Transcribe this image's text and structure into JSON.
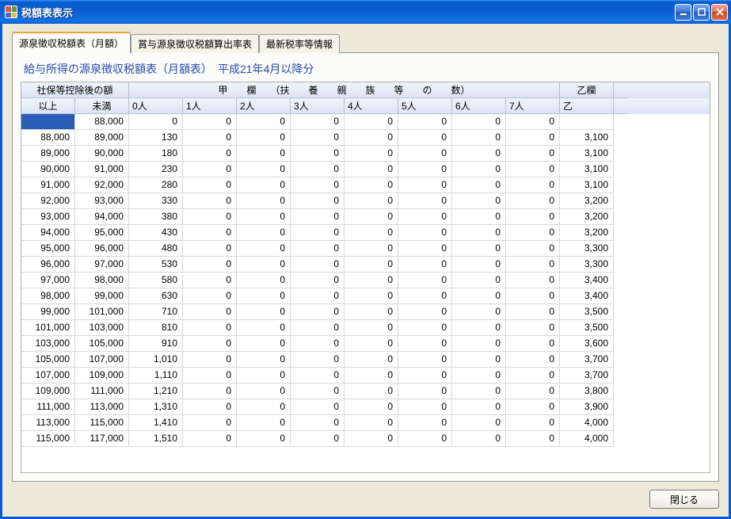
{
  "window": {
    "title": "税額表表示"
  },
  "tabs": [
    {
      "label": "源泉徴収税額表（月額）",
      "active": true
    },
    {
      "label": "賞与源泉徴収税額算出率表",
      "active": false
    },
    {
      "label": "最新税率等情報",
      "active": false
    }
  ],
  "subtitle": "給与所得の源泉徴収税額表（月額表）　平成21年4月以降分",
  "headers": {
    "shakai_span": "社保等控除後の額",
    "kou_span": "甲　　欄　　（扶　　養　　親　　族　　等　　の　　数）",
    "otsu_span": "乙欄",
    "ijo": "以上",
    "miman": "未満",
    "p0": "0人",
    "p1": "1人",
    "p2": "2人",
    "p3": "3人",
    "p4": "4人",
    "p5": "5人",
    "p6": "6人",
    "p7": "7人",
    "otsu": "乙"
  },
  "rows": [
    {
      "ijo": "",
      "miman": "88,000",
      "p0": "0",
      "p1": "0",
      "p2": "0",
      "p3": "0",
      "p4": "0",
      "p5": "0",
      "p6": "0",
      "p7": "0",
      "otsu": ""
    },
    {
      "ijo": "88,000",
      "miman": "89,000",
      "p0": "130",
      "p1": "0",
      "p2": "0",
      "p3": "0",
      "p4": "0",
      "p5": "0",
      "p6": "0",
      "p7": "0",
      "otsu": "3,100"
    },
    {
      "ijo": "89,000",
      "miman": "90,000",
      "p0": "180",
      "p1": "0",
      "p2": "0",
      "p3": "0",
      "p4": "0",
      "p5": "0",
      "p6": "0",
      "p7": "0",
      "otsu": "3,100"
    },
    {
      "ijo": "90,000",
      "miman": "91,000",
      "p0": "230",
      "p1": "0",
      "p2": "0",
      "p3": "0",
      "p4": "0",
      "p5": "0",
      "p6": "0",
      "p7": "0",
      "otsu": "3,100"
    },
    {
      "ijo": "91,000",
      "miman": "92,000",
      "p0": "280",
      "p1": "0",
      "p2": "0",
      "p3": "0",
      "p4": "0",
      "p5": "0",
      "p6": "0",
      "p7": "0",
      "otsu": "3,100"
    },
    {
      "ijo": "92,000",
      "miman": "93,000",
      "p0": "330",
      "p1": "0",
      "p2": "0",
      "p3": "0",
      "p4": "0",
      "p5": "0",
      "p6": "0",
      "p7": "0",
      "otsu": "3,200"
    },
    {
      "ijo": "93,000",
      "miman": "94,000",
      "p0": "380",
      "p1": "0",
      "p2": "0",
      "p3": "0",
      "p4": "0",
      "p5": "0",
      "p6": "0",
      "p7": "0",
      "otsu": "3,200"
    },
    {
      "ijo": "94,000",
      "miman": "95,000",
      "p0": "430",
      "p1": "0",
      "p2": "0",
      "p3": "0",
      "p4": "0",
      "p5": "0",
      "p6": "0",
      "p7": "0",
      "otsu": "3,200"
    },
    {
      "ijo": "95,000",
      "miman": "96,000",
      "p0": "480",
      "p1": "0",
      "p2": "0",
      "p3": "0",
      "p4": "0",
      "p5": "0",
      "p6": "0",
      "p7": "0",
      "otsu": "3,300"
    },
    {
      "ijo": "96,000",
      "miman": "97,000",
      "p0": "530",
      "p1": "0",
      "p2": "0",
      "p3": "0",
      "p4": "0",
      "p5": "0",
      "p6": "0",
      "p7": "0",
      "otsu": "3,300"
    },
    {
      "ijo": "97,000",
      "miman": "98,000",
      "p0": "580",
      "p1": "0",
      "p2": "0",
      "p3": "0",
      "p4": "0",
      "p5": "0",
      "p6": "0",
      "p7": "0",
      "otsu": "3,400"
    },
    {
      "ijo": "98,000",
      "miman": "99,000",
      "p0": "630",
      "p1": "0",
      "p2": "0",
      "p3": "0",
      "p4": "0",
      "p5": "0",
      "p6": "0",
      "p7": "0",
      "otsu": "3,400"
    },
    {
      "ijo": "99,000",
      "miman": "101,000",
      "p0": "710",
      "p1": "0",
      "p2": "0",
      "p3": "0",
      "p4": "0",
      "p5": "0",
      "p6": "0",
      "p7": "0",
      "otsu": "3,500"
    },
    {
      "ijo": "101,000",
      "miman": "103,000",
      "p0": "810",
      "p1": "0",
      "p2": "0",
      "p3": "0",
      "p4": "0",
      "p5": "0",
      "p6": "0",
      "p7": "0",
      "otsu": "3,500"
    },
    {
      "ijo": "103,000",
      "miman": "105,000",
      "p0": "910",
      "p1": "0",
      "p2": "0",
      "p3": "0",
      "p4": "0",
      "p5": "0",
      "p6": "0",
      "p7": "0",
      "otsu": "3,600"
    },
    {
      "ijo": "105,000",
      "miman": "107,000",
      "p0": "1,010",
      "p1": "0",
      "p2": "0",
      "p3": "0",
      "p4": "0",
      "p5": "0",
      "p6": "0",
      "p7": "0",
      "otsu": "3,700"
    },
    {
      "ijo": "107,000",
      "miman": "109,000",
      "p0": "1,110",
      "p1": "0",
      "p2": "0",
      "p3": "0",
      "p4": "0",
      "p5": "0",
      "p6": "0",
      "p7": "0",
      "otsu": "3,700"
    },
    {
      "ijo": "109,000",
      "miman": "111,000",
      "p0": "1,210",
      "p1": "0",
      "p2": "0",
      "p3": "0",
      "p4": "0",
      "p5": "0",
      "p6": "0",
      "p7": "0",
      "otsu": "3,800"
    },
    {
      "ijo": "111,000",
      "miman": "113,000",
      "p0": "1,310",
      "p1": "0",
      "p2": "0",
      "p3": "0",
      "p4": "0",
      "p5": "0",
      "p6": "0",
      "p7": "0",
      "otsu": "3,900"
    },
    {
      "ijo": "113,000",
      "miman": "115,000",
      "p0": "1,410",
      "p1": "0",
      "p2": "0",
      "p3": "0",
      "p4": "0",
      "p5": "0",
      "p6": "0",
      "p7": "0",
      "otsu": "4,000"
    },
    {
      "ijo": "115,000",
      "miman": "117,000",
      "p0": "1,510",
      "p1": "0",
      "p2": "0",
      "p3": "0",
      "p4": "0",
      "p5": "0",
      "p6": "0",
      "p7": "0",
      "otsu": "4,000"
    }
  ],
  "buttons": {
    "close": "閉じる"
  }
}
